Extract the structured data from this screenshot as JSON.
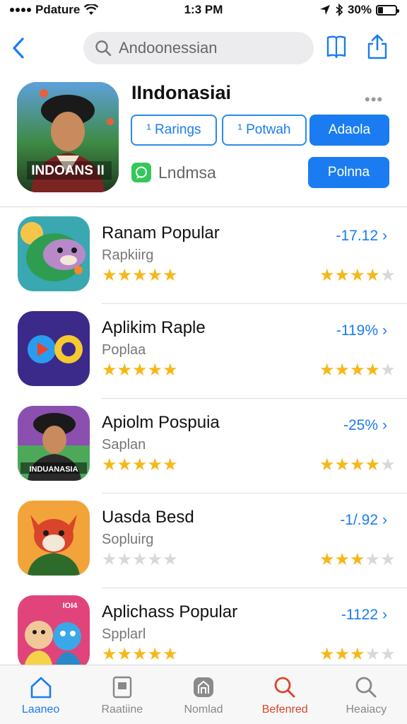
{
  "status_bar": {
    "carrier": "Pdature",
    "time": "1:3 PM",
    "battery": "30%",
    "battery_level": 0.3
  },
  "search": {
    "query": "Andoonessian"
  },
  "app": {
    "title": "IIndonasiai",
    "icon_text": "INDOANS II",
    "buttons": {
      "ratings": "¹ Rarings",
      "outline2": "¹ Potwah",
      "primary1": "Adaola",
      "primary2": "Polnna"
    },
    "message": "Lndmsa"
  },
  "list": [
    {
      "title": "Ranam Popular",
      "subtitle": "Rapkiirg",
      "value": "-17.12",
      "rating": 5,
      "right_rating": 3.5
    },
    {
      "title": "Aplikim Raple",
      "subtitle": "Poplaa",
      "value": "-119%",
      "rating": 5,
      "right_rating": 4
    },
    {
      "title": "Apiolm Pospuia",
      "subtitle": "Saplan",
      "value": "-25%",
      "rating": 5,
      "right_rating": 3.5,
      "icon_text": "INDUANASIA"
    },
    {
      "title": "Uasda Besd",
      "subtitle": "Sopluirg",
      "value": "-1/.92",
      "rating": 0,
      "right_rating": 3
    },
    {
      "title": "Aplichass Popular",
      "subtitle": "Spplarl",
      "value": "-1122",
      "rating": 5,
      "right_rating": 3,
      "icon_text": "IOI4"
    }
  ],
  "tabs": [
    {
      "label": "Laaneo",
      "icon": "home-icon"
    },
    {
      "label": "Raatiine",
      "icon": "device-icon"
    },
    {
      "label": "Nomlad",
      "icon": "store-icon"
    },
    {
      "label": "Befenred",
      "icon": "search-icon"
    },
    {
      "label": "Heaiacy",
      "icon": "search-icon"
    }
  ],
  "colors": {
    "accent": "#1a7cf0",
    "star": "#f5b819",
    "red_tab": "#d8452b"
  }
}
